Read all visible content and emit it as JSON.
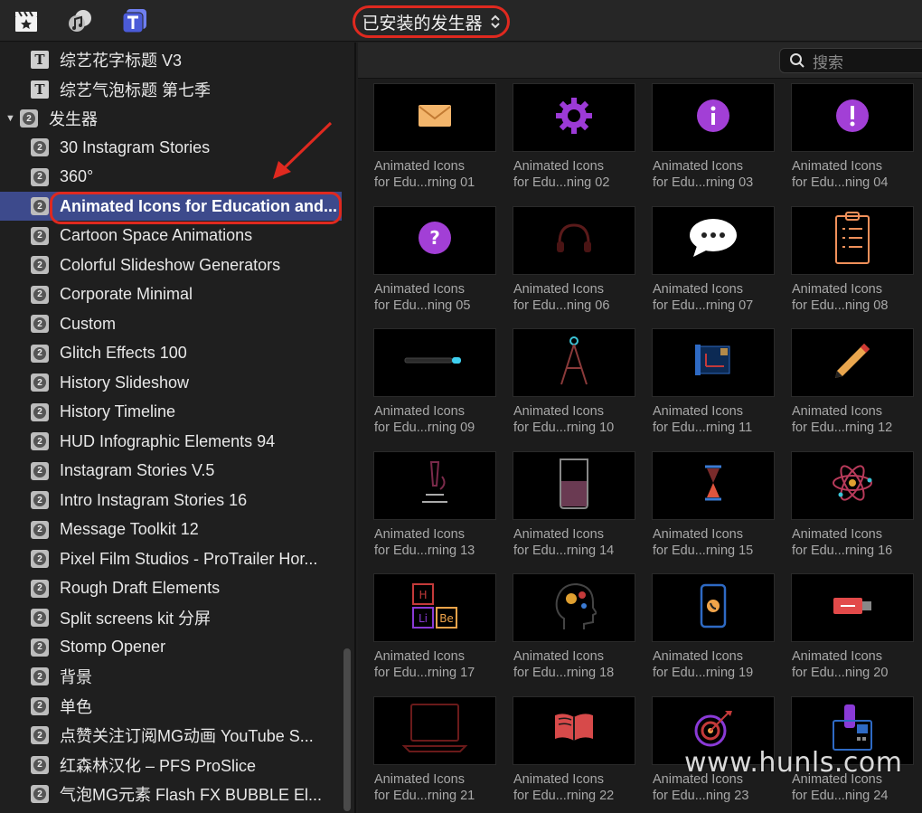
{
  "toolbar": {
    "icons": [
      "clapper-star-icon",
      "music-photo-icon",
      "title-generator-icon"
    ],
    "generator_menu": "已安装的发生器",
    "accent": "#e0291f"
  },
  "sidebar": {
    "titles": [
      "综艺花字标题 V3",
      "综艺气泡标题 第七季"
    ],
    "group": "发生器",
    "items": [
      "30 Instagram Stories",
      "360°",
      "Animated Icons for Education and...",
      "Cartoon Space Animations",
      "Colorful Slideshow Generators",
      "Corporate Minimal",
      "Custom",
      "Glitch Effects 100",
      "History Slideshow",
      "History Timeline",
      "HUD Infographic Elements 94",
      "Instagram Stories V.5",
      "Intro Instagram Stories 16",
      "Message Toolkit 12",
      "Pixel Film Studios - ProTrailer Hor...",
      "Rough Draft Elements",
      "Split screens kit 分屏",
      "Stomp Opener",
      "背景",
      "单色",
      "点赞关注订阅MG动画 YouTube S...",
      "红森林汉化 – PFS ProSlice",
      "气泡MG元素 Flash FX BUBBLE El..."
    ],
    "selected_index": 2,
    "selection_color": "#3d4a8c"
  },
  "search": {
    "placeholder": "搜索"
  },
  "tiles": [
    {
      "line1": "Animated Icons",
      "line2": "for Edu...rning 01",
      "icon": "envelope-icon"
    },
    {
      "line1": "Animated Icons",
      "line2": "for Edu...ning 02",
      "icon": "gear-icon"
    },
    {
      "line1": "Animated Icons",
      "line2": "for Edu...rning 03",
      "icon": "info-icon"
    },
    {
      "line1": "Animated Icons",
      "line2": "for Edu...ning 04",
      "icon": "exclamation-icon"
    },
    {
      "line1": "Animated Icons",
      "line2": "for Edu...ning 05",
      "icon": "question-icon"
    },
    {
      "line1": "Animated Icons",
      "line2": "for Edu...ning 06",
      "icon": "headphones-icon"
    },
    {
      "line1": "Animated Icons",
      "line2": "for Edu...rning 07",
      "icon": "chat-bubble-icon"
    },
    {
      "line1": "Animated Icons",
      "line2": "for Edu...ning 08",
      "icon": "clipboard-icon"
    },
    {
      "line1": "Animated Icons",
      "line2": "for Edu...rning 09",
      "icon": "pen-icon"
    },
    {
      "line1": "Animated Icons",
      "line2": "for Edu...rning 10",
      "icon": "compass-icon"
    },
    {
      "line1": "Animated Icons",
      "line2": "for Edu...rning 11",
      "icon": "blueprint-icon"
    },
    {
      "line1": "Animated Icons",
      "line2": "for Edu...rning 12",
      "icon": "pencil-icon"
    },
    {
      "line1": "Animated Icons",
      "line2": "for Edu...rning 13",
      "icon": "microscope-icon"
    },
    {
      "line1": "Animated Icons",
      "line2": "for Edu...rning 14",
      "icon": "beaker-icon"
    },
    {
      "line1": "Animated Icons",
      "line2": "for Edu...rning 15",
      "icon": "hourglass-icon"
    },
    {
      "line1": "Animated Icons",
      "line2": "for Edu...rning 16",
      "icon": "atom-icon"
    },
    {
      "line1": "Animated Icons",
      "line2": "for Edu...rning 17",
      "icon": "periodic-elements-icon",
      "labels": [
        "H",
        "Li",
        "Be"
      ]
    },
    {
      "line1": "Animated Icons",
      "line2": "for Edu...rning 18",
      "icon": "head-gears-icon"
    },
    {
      "line1": "Animated Icons",
      "line2": "for Edu...rning 19",
      "icon": "phone-icon"
    },
    {
      "line1": "Animated Icons",
      "line2": "for Edu...ning 20",
      "icon": "usb-drive-icon"
    },
    {
      "line1": "Animated Icons",
      "line2": "for Edu...rning 21",
      "icon": "laptop-icon"
    },
    {
      "line1": "Animated Icons",
      "line2": "for Edu...rning 22",
      "icon": "open-book-icon"
    },
    {
      "line1": "Animated Icons",
      "line2": "for Edu...ning 23",
      "icon": "target-icon"
    },
    {
      "line1": "Animated Icons",
      "line2": "for Edu...ning 24",
      "icon": "desk-phone-icon"
    }
  ],
  "watermark": "www.hunls.com"
}
